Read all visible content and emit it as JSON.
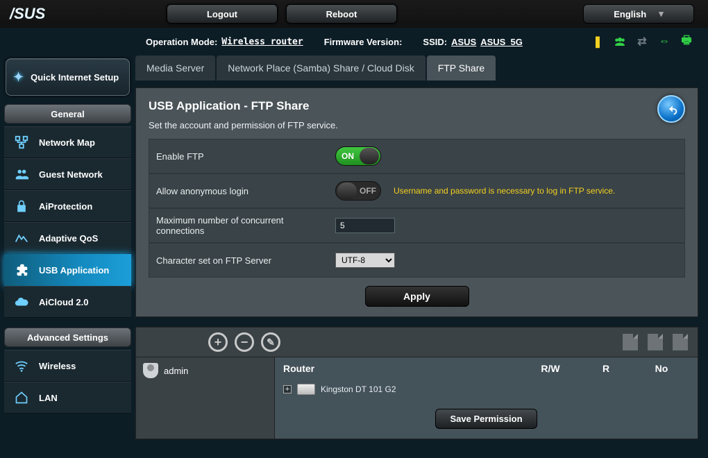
{
  "brand": "/SUS",
  "topbar": {
    "logout": "Logout",
    "reboot": "Reboot",
    "language": "English"
  },
  "status": {
    "opmode_label": "Operation Mode:",
    "opmode_value": "Wireless router",
    "fw_label": "Firmware Version:",
    "ssid_label": "SSID:",
    "ssid1": "ASUS",
    "ssid2": "ASUS_5G"
  },
  "sidebar": {
    "qis": "Quick Internet Setup",
    "general_label": "General",
    "general": [
      {
        "label": "Network Map"
      },
      {
        "label": "Guest Network"
      },
      {
        "label": "AiProtection"
      },
      {
        "label": "Adaptive QoS"
      },
      {
        "label": "USB Application"
      },
      {
        "label": "AiCloud 2.0"
      }
    ],
    "advanced_label": "Advanced Settings",
    "advanced": [
      {
        "label": "Wireless"
      },
      {
        "label": "LAN"
      }
    ]
  },
  "tabs": {
    "t0": "Media Server",
    "t1": "Network Place (Samba) Share / Cloud Disk",
    "t2": "FTP Share"
  },
  "panel": {
    "title": "USB Application - FTP Share",
    "desc": "Set the account and permission of FTP service.",
    "rows": {
      "enable_ftp": "Enable FTP",
      "enable_ftp_state": "ON",
      "anon": "Allow anonymous login",
      "anon_state": "OFF",
      "anon_hint": "Username and password is necessary to log in FTP service.",
      "maxconn": "Maximum number of concurrent connections",
      "maxconn_value": "5",
      "charset": "Character set on FTP Server",
      "charset_value": "UTF-8"
    },
    "apply": "Apply"
  },
  "perm": {
    "user": "admin",
    "col_router": "Router",
    "col_rw": "R/W",
    "col_r": "R",
    "col_no": "No",
    "device": "Kingston DT 101 G2",
    "save": "Save Permission"
  }
}
